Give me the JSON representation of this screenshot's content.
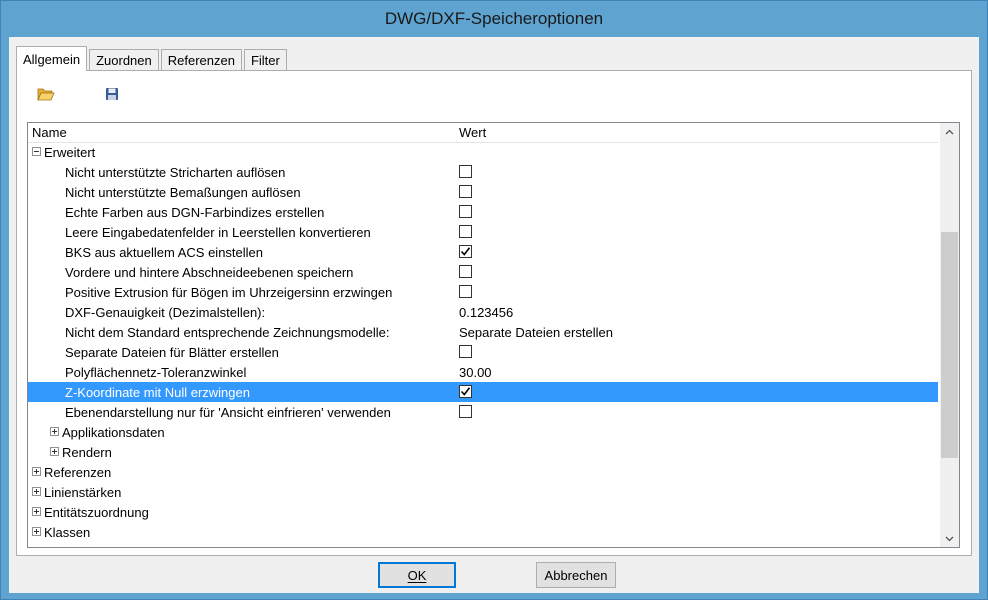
{
  "window": {
    "title": "DWG/DXF-Speicheroptionen"
  },
  "tabs": [
    {
      "label": "Allgemein",
      "active": true
    },
    {
      "label": "Zuordnen",
      "active": false
    },
    {
      "label": "Referenzen",
      "active": false
    },
    {
      "label": "Filter",
      "active": false
    }
  ],
  "toolbar": {
    "open_icon": "folder-open-icon",
    "save_icon": "floppy-disk-icon"
  },
  "grid": {
    "header": {
      "name": "Name",
      "value": "Wert"
    },
    "group_erweitert": "Erweitert",
    "items": [
      {
        "label": "Nicht unterstützte Stricharten auflösen",
        "checked": false
      },
      {
        "label": "Nicht unterstützte Bemaßungen auflösen",
        "checked": false
      },
      {
        "label": "Echte Farben aus DGN-Farbindizes erstellen",
        "checked": false
      },
      {
        "label": "Leere Eingabedatenfelder in Leerstellen konvertieren",
        "checked": false
      },
      {
        "label": "BKS aus aktuellem ACS einstellen",
        "checked": true
      },
      {
        "label": "Vordere und hintere Abschneideebenen speichern",
        "checked": false
      },
      {
        "label": "Positive Extrusion für Bögen im Uhrzeigersinn erzwingen",
        "checked": false
      },
      {
        "label": "DXF-Genauigkeit (Dezimalstellen):",
        "value": "0.123456"
      },
      {
        "label": "Nicht dem Standard entsprechende Zeichnungsmodelle:",
        "value": "Separate Dateien erstellen"
      },
      {
        "label": "Separate Dateien für Blätter erstellen",
        "checked": false
      },
      {
        "label": "Polyflächennetz-Toleranzwinkel",
        "value": "30.00"
      },
      {
        "label": "Z-Koordinate mit Null erzwingen",
        "checked": true,
        "selected": true
      },
      {
        "label": "Ebenendarstellung nur für 'Ansicht einfrieren' verwenden",
        "checked": false
      }
    ],
    "subgroups": [
      "Applikationsdaten",
      "Rendern"
    ],
    "top_groups": [
      "Referenzen",
      "Linienstärken",
      "Entitätszuordnung",
      "Klassen"
    ]
  },
  "buttons": {
    "ok": "OK",
    "cancel": "Abbrechen"
  },
  "colors": {
    "selection": "#3399ff",
    "title_bar": "#5fa3d0"
  }
}
